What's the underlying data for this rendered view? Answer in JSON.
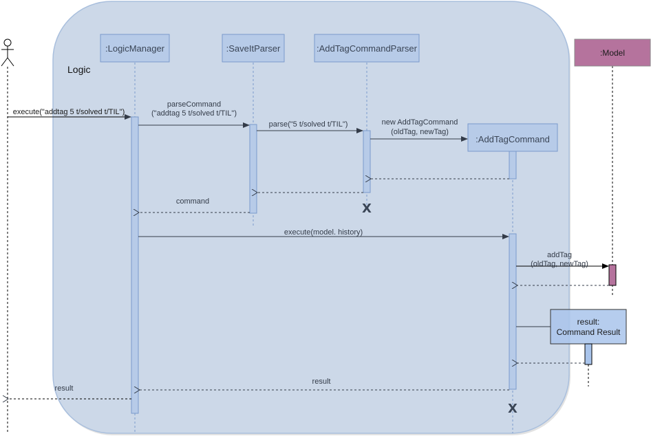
{
  "diagram": {
    "type": "sequence",
    "frame": {
      "label": "Logic",
      "fill": "#ccd8e8",
      "stroke": "#a9bfdd"
    },
    "actor": {
      "name": "user-actor"
    },
    "participants": [
      {
        "id": "logicmanager",
        "label": ":LogicManager",
        "fill": "#b7cbe8",
        "stroke": "#7a9acb"
      },
      {
        "id": "saveitparser",
        "label": ":SaveItParser",
        "fill": "#b7cbe8",
        "stroke": "#7a9acb"
      },
      {
        "id": "addtagcommandparser",
        "label": ":AddTagCommandParser",
        "fill": "#b7cbe8",
        "stroke": "#7a9acb"
      },
      {
        "id": "addtagcommand",
        "label": ":AddTagCommand",
        "fill": "#b7cbe8",
        "stroke": "#7a9acb"
      },
      {
        "id": "model",
        "label": ":Model",
        "fill": "#b5739d",
        "stroke": "#8a8a8a"
      },
      {
        "id": "commandresult",
        "label_line1": "result:",
        "label_line2": "Command Result",
        "fill": "#a9c4eb",
        "stroke": "#333333"
      }
    ],
    "messages": [
      {
        "id": "m1",
        "label": "execute(\"addtag 5 t/solved t/TIL\")",
        "kind": "sync"
      },
      {
        "id": "m2",
        "label_line1": "parseCommand",
        "label_line2": "(\"addtag 5 t/solved t/TIL\")",
        "kind": "sync"
      },
      {
        "id": "m3",
        "label": "parse(\"5 t/solved t/TIL\")",
        "kind": "sync"
      },
      {
        "id": "m4",
        "label_line1": "new AddTagCommand",
        "label_line2": "(oldTag, newTag)",
        "kind": "create"
      },
      {
        "id": "m5",
        "label": "",
        "kind": "return"
      },
      {
        "id": "m6",
        "label": "",
        "kind": "return"
      },
      {
        "id": "m7",
        "label": "command",
        "kind": "return"
      },
      {
        "id": "m8",
        "label": "execute(model. history)",
        "kind": "sync"
      },
      {
        "id": "m9",
        "label_line1": "addTag",
        "label_line2": "(oldTag, newTag)",
        "kind": "sync"
      },
      {
        "id": "m10",
        "label": "",
        "kind": "return"
      },
      {
        "id": "m11",
        "label": "",
        "kind": "create"
      },
      {
        "id": "m12",
        "label": "",
        "kind": "return"
      },
      {
        "id": "m13",
        "label": "result",
        "kind": "return"
      },
      {
        "id": "m14",
        "label": "result",
        "kind": "return"
      }
    ],
    "destroy_marker": "X"
  }
}
